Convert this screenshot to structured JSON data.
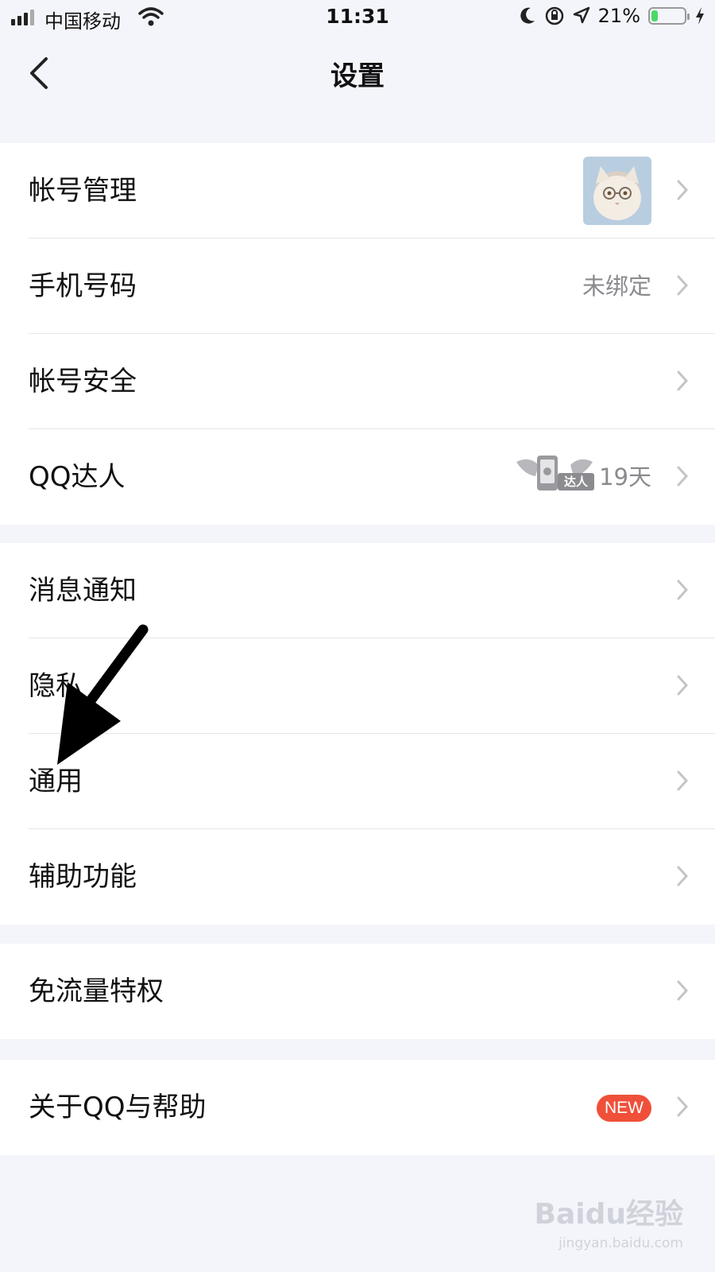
{
  "status_bar": {
    "carrier": "中国移动",
    "time": "11:31",
    "battery_text": "21%",
    "battery_level": 0.21,
    "icons": [
      "signal-icon",
      "wifi-icon",
      "moon-icon",
      "rotation-lock-icon",
      "location-arrow-icon",
      "battery-icon",
      "charging-icon"
    ]
  },
  "nav": {
    "title": "设置",
    "back_icon": "back-chevron-icon"
  },
  "groups": [
    {
      "rows": [
        {
          "label": "帐号管理",
          "accessory": "avatar"
        },
        {
          "label": "手机号码",
          "value": "未绑定"
        },
        {
          "label": "帐号安全"
        },
        {
          "label": "QQ达人",
          "badge": "达人",
          "value": "19天"
        }
      ]
    },
    {
      "rows": [
        {
          "label": "消息通知"
        },
        {
          "label": "隐私"
        },
        {
          "label": "通用"
        },
        {
          "label": "辅助功能"
        }
      ]
    },
    {
      "rows": [
        {
          "label": "免流量特权"
        }
      ]
    },
    {
      "rows": [
        {
          "label": "关于QQ与帮助",
          "badge": "NEW"
        }
      ]
    }
  ],
  "watermark": {
    "text": "Baidu经验",
    "sub": "jingyan.baidu.com"
  },
  "colors": {
    "background": "#f4f5fa",
    "new_badge": "#f0503a",
    "battery_fill": "#4cd964",
    "secondary_text": "#8a8a8f"
  }
}
